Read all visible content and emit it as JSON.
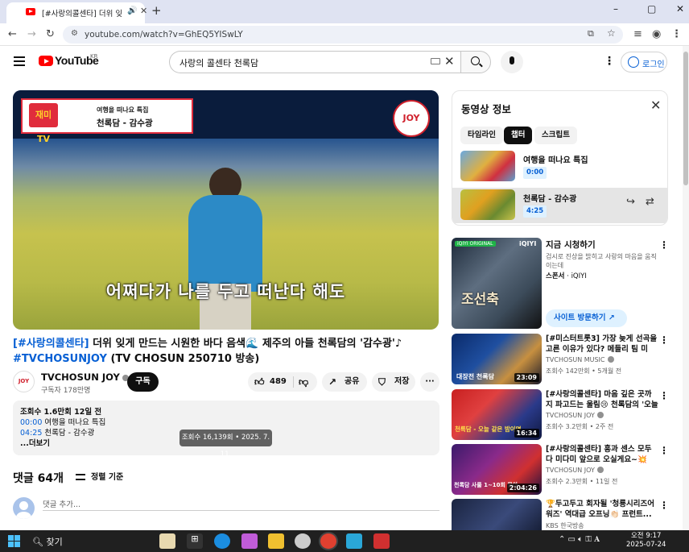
{
  "browser": {
    "tab_title": "[#사랑의콜센타] 더위 잊게",
    "new_tab": "+",
    "url": "youtube.com/watch?v=GhEQ5YISwLY",
    "window_controls": [
      "–",
      "▢",
      "✕"
    ]
  },
  "youtube": {
    "logo_text": "YouTube",
    "region": "KR",
    "search_query": "사랑의 콜센타 천록담",
    "login_label": "로그인"
  },
  "video": {
    "overlay_line1": "여행을 떠나요 특집",
    "overlay_line2": "천록담 - 감수광",
    "overlay_logo": "재미TV",
    "joy_logo": "JOY",
    "subtitle": "어쩌다가 나를 두고 떠난다 해도",
    "title_tag1": "[#사랑의콜센타]",
    "title_main": " 더위 잊게 만드는 시원한 바다 음색🌊 제주의 아들 천록담의 '감수광'♪",
    "title_tag2": "#TVCHOSUNJOY",
    "title_tail": " (TV CHOSUN 250710 방송)"
  },
  "channel": {
    "name": "TVCHOSUN JOY",
    "subscribers": "구독자 178만명",
    "subscribe_label": "구독",
    "avatar_text": "JOY"
  },
  "actions": {
    "likes": "489",
    "share": "공유",
    "save": "저장",
    "more": "···"
  },
  "description": {
    "meta": "조회수 1.6만회  12일 전",
    "chapter1_time": "00:00",
    "chapter1_title": " 여행을 떠나요 특집",
    "chapter2_time": "04:25",
    "chapter2_title": " 천록담 - 감수광",
    "more_label": "...더보기",
    "tooltip": "조회수 16,139회 • 2025. 7. 11."
  },
  "comments": {
    "count": "댓글 64개",
    "sort_label": "정렬 기준",
    "placeholder": "댓글 추가..."
  },
  "panel": {
    "title": "동영상 정보",
    "tabs": [
      "타임라인",
      "챕터",
      "스크립트"
    ],
    "active_tab": "챕터",
    "chapters": [
      {
        "title": "여행을 떠나요 특집",
        "time": "0:00"
      },
      {
        "title": "천록담 - 감수광",
        "time": "4:25"
      }
    ]
  },
  "ad": {
    "badge": "iQIYI ORIGINAL",
    "brand": "iQIYI",
    "thumb_text": "조선축",
    "title": "지금 시청하기",
    "desc": "검시로 진상을 밝히고 사랑의 마음을 움직이는데",
    "sponsor_prefix": "스폰서",
    "sponsor": " · iQIYI",
    "cta": "사이트 방문하기"
  },
  "recommendations": [
    {
      "title": "[#미스터트롯3] 가장 늦게 선곡을 고른 이유가 있다? 메들리 팀 미션...",
      "channel": "TVCHOSUN MUSIC",
      "views": "조회수 142만회 • 5개월 전",
      "duration": "23:09",
      "thumb_text": "대장전 천록담"
    },
    {
      "title": "[#사랑의콜센타] 마음 깊은 곳까지 파고드는 울림😢 천록담의 '오늘 ...",
      "channel": "TVCHOSUN JOY",
      "views": "조회수 3.2만회 • 2주 전",
      "duration": "16:34",
      "thumb_text": "천록담 - 오늘 같은 밤이면"
    },
    {
      "title": "[#사랑의콜센타] 흥과 센스 모두 다 미다미 앞으로 오실게요~💥 천...",
      "channel": "TVCHOSUN JOY",
      "views": "조회수 2.3만회 • 11일 전",
      "duration": "2:04:26",
      "thumb_text": "천록담 사룰 1~10회 몰아"
    },
    {
      "title": "🏆두고두고 회자될 '청룡시리즈어워즈' 역대급 오프닝👏🏻 프런트...",
      "channel": "KBS 한국방송",
      "views": "",
      "duration": "",
      "thumb_text": ""
    }
  ],
  "taskbar": {
    "search": "찾기",
    "time": "오전 9:17",
    "date": "2025-07-24"
  },
  "colors": {
    "accent": "#065fd4",
    "youtube_red": "#ff0000",
    "taskbar": "#202020"
  }
}
